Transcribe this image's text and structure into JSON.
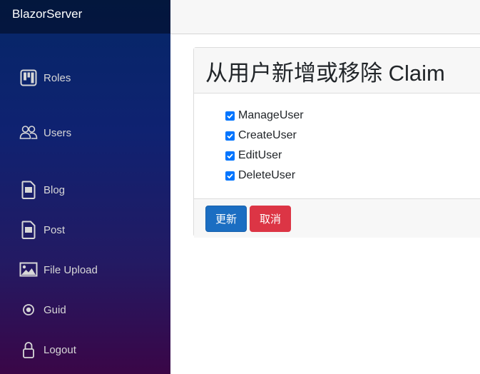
{
  "app": {
    "brand": "BlazorServer"
  },
  "nav": {
    "items": [
      {
        "label": "Roles",
        "icon": "roles-icon"
      },
      {
        "label": "Users",
        "icon": "users-icon"
      },
      {
        "label": "Blog",
        "icon": "document-icon"
      },
      {
        "label": "Post",
        "icon": "document-icon"
      },
      {
        "label": "File Upload",
        "icon": "image-icon"
      },
      {
        "label": "Guid",
        "icon": "radio-icon"
      },
      {
        "label": "Logout",
        "icon": "lock-icon"
      }
    ]
  },
  "page": {
    "title": "从用户新增或移除 Claim",
    "claims": [
      {
        "label": "ManageUser",
        "checked": true
      },
      {
        "label": "CreateUser",
        "checked": true
      },
      {
        "label": "EditUser",
        "checked": true
      },
      {
        "label": "DeleteUser",
        "checked": true
      }
    ],
    "buttons": {
      "update": "更新",
      "cancel": "取消"
    }
  },
  "colors": {
    "primary": "#1b6ec2",
    "danger": "#dc3545",
    "checkbox": "#0075ff"
  }
}
